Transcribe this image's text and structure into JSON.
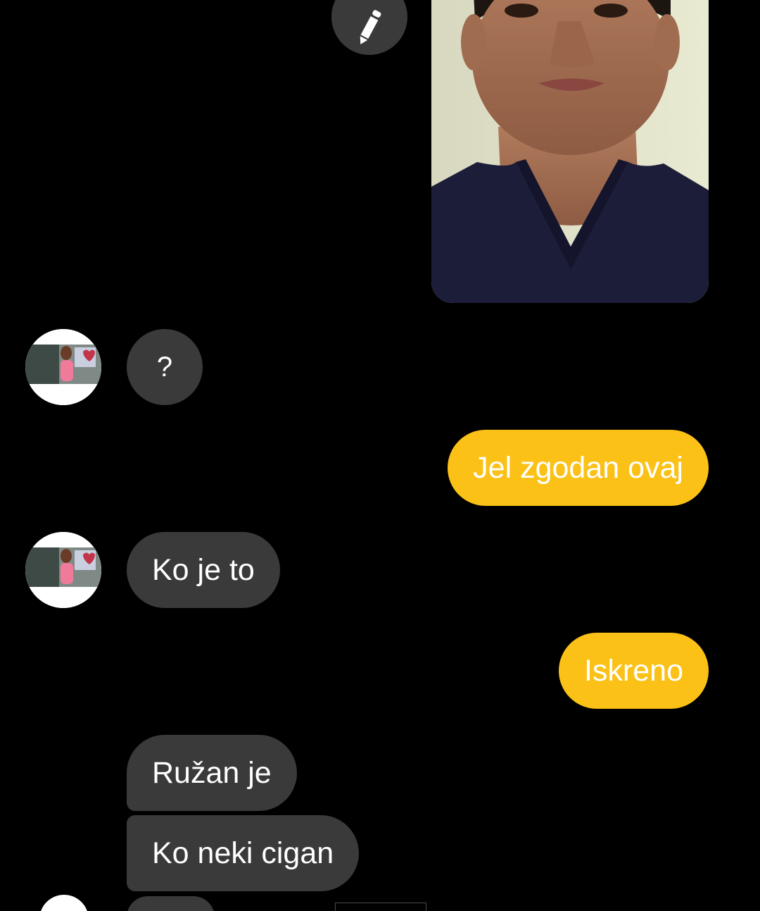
{
  "chat": {
    "messages": [
      {
        "from": "me",
        "kind": "photo",
        "icon": "portrait-photo"
      },
      {
        "from": "them",
        "text": "?"
      },
      {
        "from": "me",
        "text": "Jel zgodan ovaj"
      },
      {
        "from": "them",
        "text": "Ko je to"
      },
      {
        "from": "me",
        "text": "Iskreno"
      },
      {
        "from": "them",
        "text": "Ružan je"
      },
      {
        "from": "them",
        "text": "Ko neki cigan"
      }
    ]
  },
  "icons": {
    "edit": "pencil-icon",
    "avatar": "contact-avatar"
  },
  "colors": {
    "background": "#000000",
    "incoming_bubble": "#3a3a3a",
    "outgoing_bubble": "#fbc116",
    "text": "#ffffff"
  }
}
